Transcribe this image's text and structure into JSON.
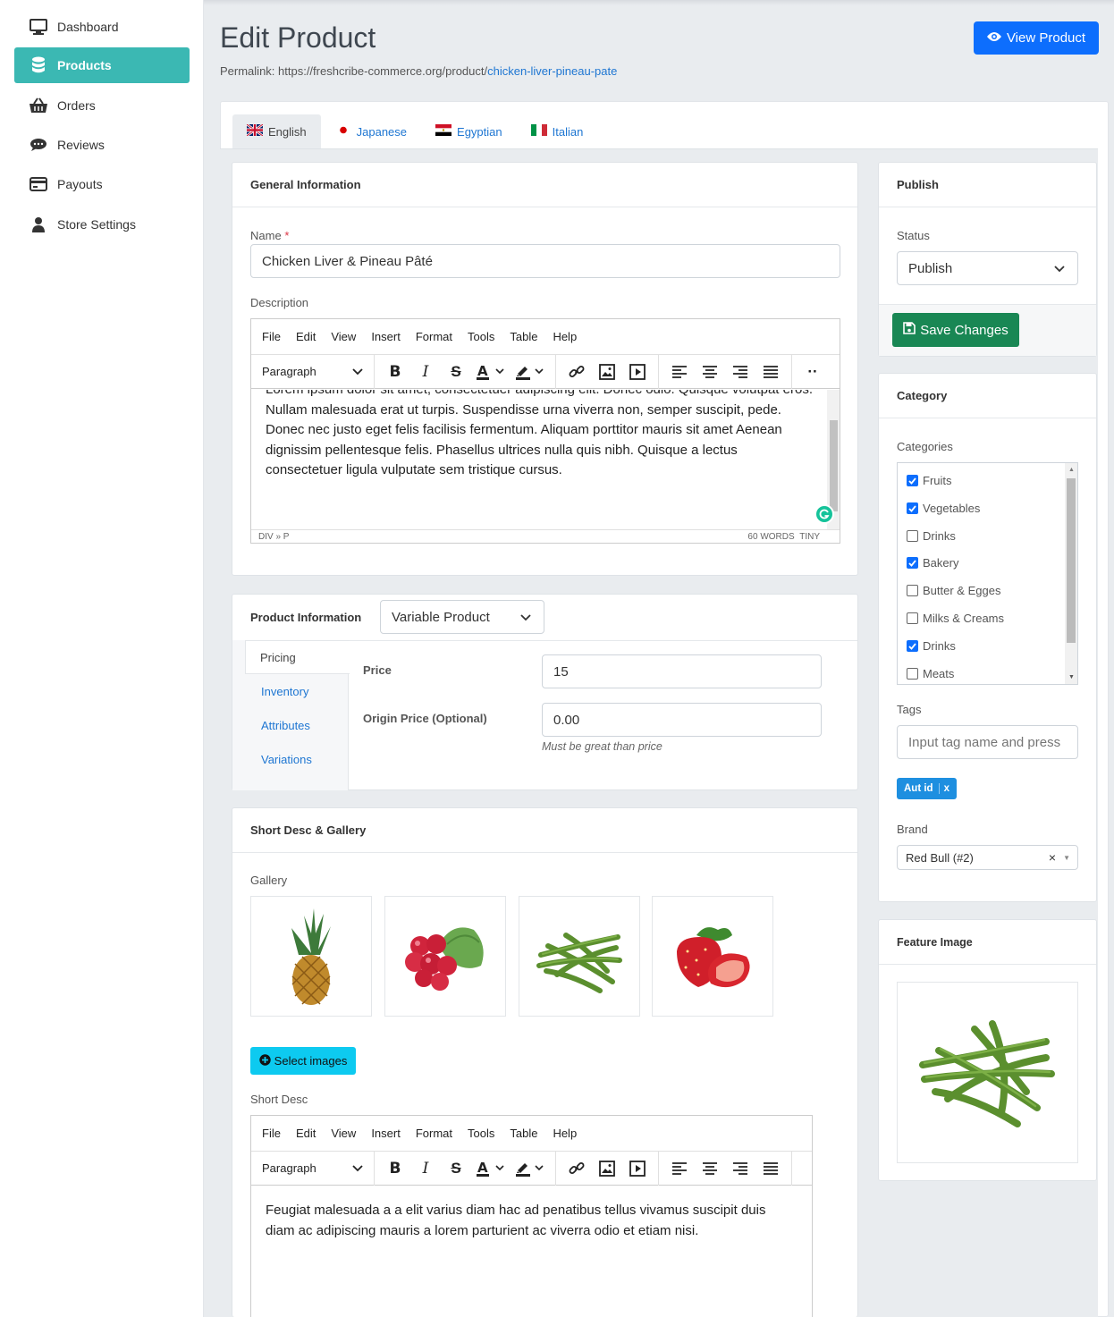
{
  "sidebar": {
    "items": [
      {
        "label": "Dashboard",
        "icon": "monitor-icon"
      },
      {
        "label": "Products",
        "icon": "database-icon",
        "active": true
      },
      {
        "label": "Orders",
        "icon": "basket-icon"
      },
      {
        "label": "Reviews",
        "icon": "comments-icon"
      },
      {
        "label": "Payouts",
        "icon": "credit-card-icon"
      },
      {
        "label": "Store Settings",
        "icon": "user-icon"
      }
    ]
  },
  "header": {
    "title": "Edit Product",
    "permalink_prefix": "Permalink: https://freshcribe-commerce.org/product/",
    "permalink_slug": "chicken-liver-pineau-pate",
    "view_button": "View Product"
  },
  "languages": [
    {
      "label": "English",
      "active": true
    },
    {
      "label": "Japanese"
    },
    {
      "label": "Egyptian"
    },
    {
      "label": "Italian"
    }
  ],
  "general": {
    "heading": "General Information",
    "name_label": "Name",
    "name_required": "*",
    "name_value": "Chicken Liver & Pineau Pâté",
    "description_label": "Description",
    "editor": {
      "menu": [
        "File",
        "Edit",
        "View",
        "Insert",
        "Format",
        "Tools",
        "Table",
        "Help"
      ],
      "block_format": "Paragraph",
      "content": "Lorem ipsum dolor sit amet, consectetuer adipiscing elit. Donec odio. Quisque volutpat eros. Nullam malesuada erat ut turpis. Suspendisse urna viverra non, semper suscipit, pede. Donec nec justo eget felis facilisis fermentum. Aliquam porttitor mauris sit amet Aenean dignissim pellentesque felis. Phasellus ultrices nulla quis nibh. Quisque a lectus consectetuer ligula vulputate sem tristique cursus.",
      "path": "DIV » P",
      "word_count": "60 WORDS",
      "brand": "TINY"
    }
  },
  "product_info": {
    "heading": "Product Information",
    "type": "Variable Product",
    "tabs": [
      "Pricing",
      "Inventory",
      "Attributes",
      "Variations"
    ],
    "price_label": "Price",
    "price_value": "15",
    "origin_label": "Origin Price (Optional)",
    "origin_value": "0.00",
    "origin_hint": "Must be great than price"
  },
  "gallery": {
    "heading": "Short Desc & Gallery",
    "gallery_label": "Gallery",
    "images": [
      "pineapple",
      "radish",
      "green-beans",
      "strawberry"
    ],
    "select_button": "Select images",
    "short_desc_label": "Short Desc",
    "short_desc": "Feugiat malesuada a a elit varius diam hac ad penatibus tellus vivamus suscipit duis diam ac adipiscing mauris a lorem parturient ac viverra odio et etiam nisi."
  },
  "publish": {
    "heading": "Publish",
    "status_label": "Status",
    "status_value": "Publish",
    "save_button": "Save Changes"
  },
  "category": {
    "heading": "Category",
    "categories_label": "Categories",
    "items": [
      {
        "label": "Fruits",
        "checked": true
      },
      {
        "label": "Vegetables",
        "checked": true
      },
      {
        "label": "Drinks",
        "checked": false
      },
      {
        "label": "Bakery",
        "checked": true
      },
      {
        "label": "Butter & Egges",
        "checked": false
      },
      {
        "label": "Milks & Creams",
        "checked": false
      },
      {
        "label": "Drinks",
        "checked": true
      },
      {
        "label": "Meats",
        "checked": false
      }
    ],
    "tags_label": "Tags",
    "tags_placeholder": "Input tag name and press",
    "tag": "Aut id",
    "brand_label": "Brand",
    "brand_value": "Red Bull (#2)"
  },
  "feature": {
    "heading": "Feature Image",
    "image": "green-beans"
  },
  "colors": {
    "accent": "#3bb8b3",
    "primary": "#0d6efd",
    "success": "#198754",
    "info": "#0dcaf0"
  }
}
